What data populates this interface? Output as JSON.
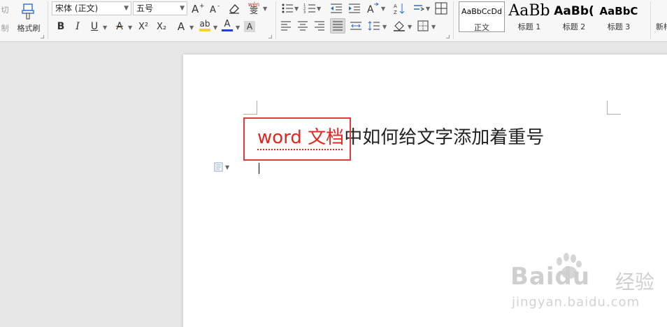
{
  "clipboard": {
    "cut_label_top": "切",
    "cut_label_bottom": "制",
    "format_painter_label": "格式刷"
  },
  "font": {
    "family_value": "宋体 (正文)",
    "size_value": "五号",
    "grow_icon": "font-grow-icon",
    "shrink_icon": "font-shrink-icon",
    "clear_format_icon": "eraser-icon",
    "phonetic_label": "wén",
    "phonetic_char": "雯",
    "bold": "B",
    "italic": "I",
    "underline": "U",
    "strikethrough": "A",
    "superscript": "X²",
    "subscript": "X₂",
    "text_effect": "A",
    "highlight": "ab",
    "font_color": "A",
    "char_shading": "A",
    "highlight_color": "#f5d328",
    "font_color_value": "#1f3fd6",
    "strike_color": "#d00000"
  },
  "styles": {
    "items": [
      {
        "sample": "AaBbCcDd",
        "name": "正文"
      },
      {
        "sample": "AaBb",
        "name": "标题 1"
      },
      {
        "sample": "AaBb(",
        "name": "标题 2"
      },
      {
        "sample": "AaBbC",
        "name": "标题 3"
      }
    ],
    "new_style_label": "新样"
  },
  "document": {
    "heading_red": "word 文档",
    "heading_rest": "中如何给文字添加着重号",
    "red_color": "#e8231f",
    "box_color": "#e23b3b"
  },
  "watermark": {
    "brand": "Baidu",
    "brand_cn": "经验",
    "url": "jingyan.baidu.com"
  }
}
